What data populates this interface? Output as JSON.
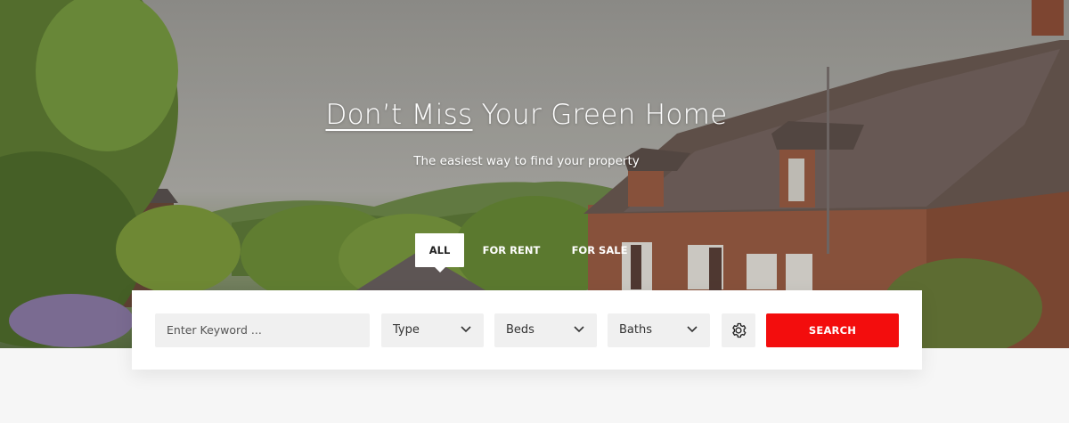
{
  "hero": {
    "headline_underlined": "Don’t Miss",
    "headline_rest": " Your Green Home",
    "subheadline": "The easiest way to find your property"
  },
  "tabs": [
    {
      "label": "ALL",
      "active": true
    },
    {
      "label": "FOR RENT",
      "active": false
    },
    {
      "label": "FOR SALE",
      "active": false
    }
  ],
  "search": {
    "keyword_placeholder": "Enter Keyword ...",
    "type_label": "Type",
    "beds_label": "Beds",
    "baths_label": "Baths",
    "advanced_icon": "gear-icon",
    "submit_label": "SEARCH"
  },
  "colors": {
    "accent": "#f30d0d",
    "panel": "#ffffff",
    "field_bg": "#f0f0f0"
  }
}
